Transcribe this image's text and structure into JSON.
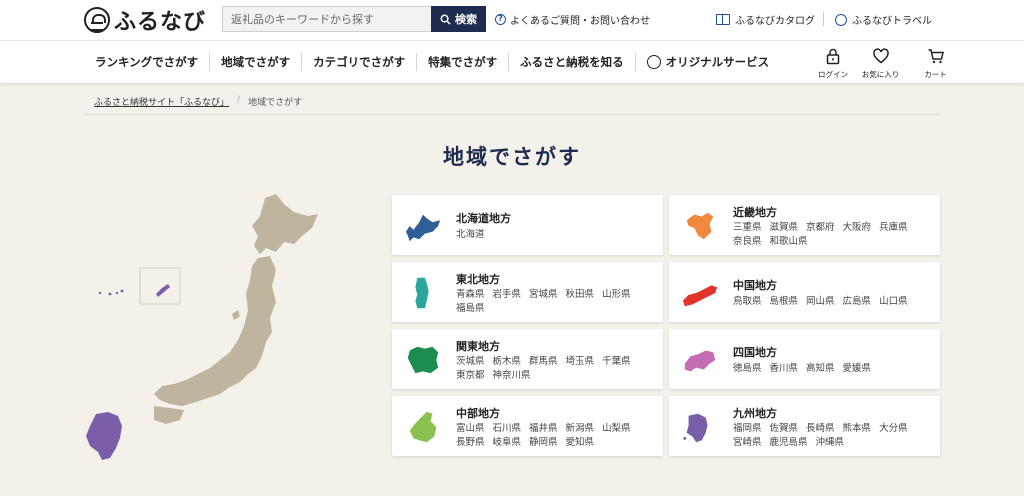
{
  "header": {
    "logo_text": "ふるなび",
    "search_placeholder": "返礼品のキーワードから探す",
    "search_button": "検索",
    "faq_link": "よくあるご質問・お問い合わせ",
    "catalog_link": "ふるなびカタログ",
    "travel_link": "ふるなびトラベル"
  },
  "nav": {
    "items": [
      "ランキングでさがす",
      "地域でさがす",
      "カテゴリでさがす",
      "特集でさがす",
      "ふるさと納税を知る",
      "オリジナルサービス"
    ],
    "icons": [
      {
        "label": "ログイン",
        "icon": "lock-icon"
      },
      {
        "label": "お気に入り",
        "icon": "heart-icon"
      },
      {
        "label": "カート",
        "icon": "cart-icon"
      }
    ]
  },
  "breadcrumb": {
    "home": "ふるさと納税サイト「ふるなび」",
    "separator": "/",
    "current": "地域でさがす"
  },
  "page_title": "地域でさがす",
  "regions": [
    {
      "name": "北海道地方",
      "prefs": [
        "北海道"
      ],
      "color": "#2f5f96"
    },
    {
      "name": "東北地方",
      "prefs": [
        "青森県",
        "岩手県",
        "宮城県",
        "秋田県",
        "山形県",
        "福島県"
      ],
      "color": "#2aa79b"
    },
    {
      "name": "関東地方",
      "prefs": [
        "茨城県",
        "栃木県",
        "群馬県",
        "埼玉県",
        "千葉県",
        "東京都",
        "神奈川県"
      ],
      "color": "#1d8c4f"
    },
    {
      "name": "中部地方",
      "prefs": [
        "富山県",
        "石川県",
        "福井県",
        "新潟県",
        "山梨県",
        "長野県",
        "岐阜県",
        "静岡県",
        "愛知県"
      ],
      "color": "#8cc152"
    },
    {
      "name": "近畿地方",
      "prefs": [
        "三重県",
        "滋賀県",
        "京都府",
        "大阪府",
        "兵庫県",
        "奈良県",
        "和歌山県"
      ],
      "color": "#f0883e"
    },
    {
      "name": "中国地方",
      "prefs": [
        "鳥取県",
        "島根県",
        "岡山県",
        "広島県",
        "山口県"
      ],
      "color": "#e0352b"
    },
    {
      "name": "四国地方",
      "prefs": [
        "徳島県",
        "香川県",
        "高知県",
        "愛媛県"
      ],
      "color": "#c56bb3"
    },
    {
      "name": "九州地方",
      "prefs": [
        "福岡県",
        "佐賀県",
        "長崎県",
        "熊本県",
        "大分県",
        "宮崎県",
        "鹿児島県",
        "沖縄県"
      ],
      "color": "#7a5fa8"
    }
  ],
  "colors": {
    "navy": "#1f2c4f",
    "map_land": "#bfb49e",
    "kyushu": "#7a5fa8",
    "background": "#f4f1ea"
  }
}
